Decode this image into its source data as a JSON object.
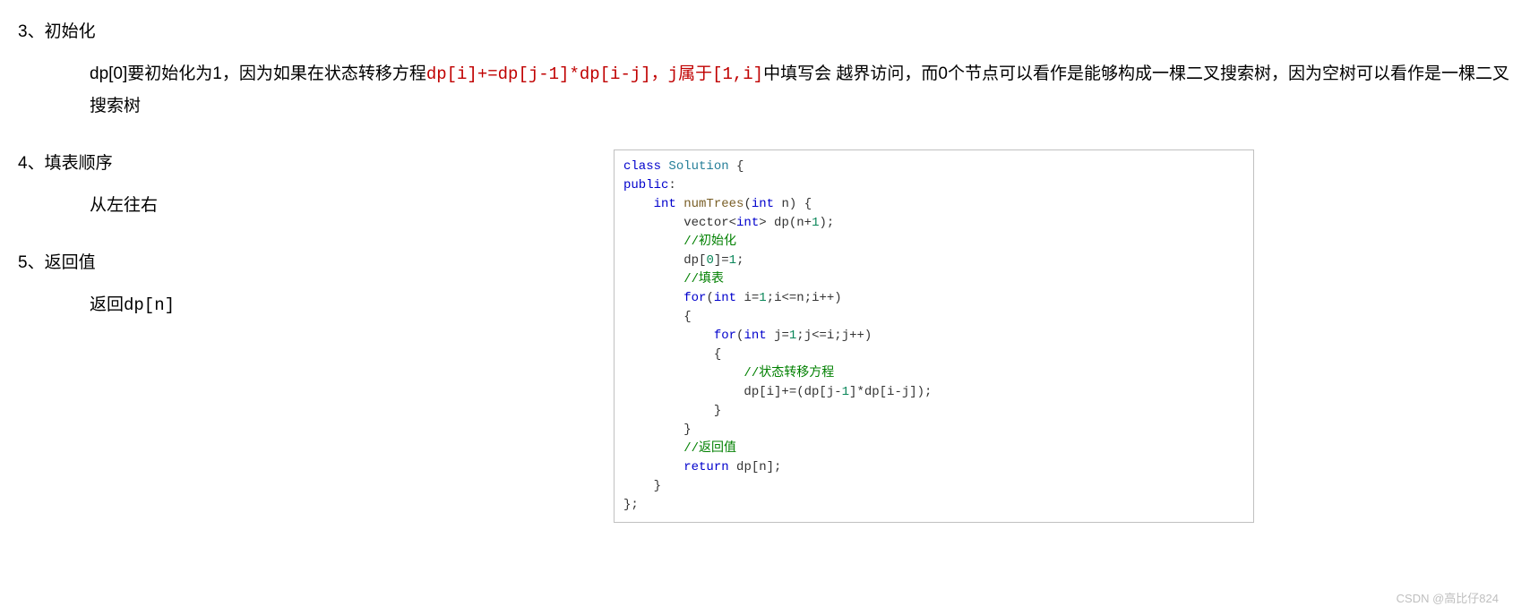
{
  "sections": {
    "s3": {
      "heading": "3、初始化",
      "para_pre": "dp[0]要初始化为1，因为如果在状态转移方程",
      "para_red": "dp[i]+=dp[j-1]*dp[i-j]，j属于[1,i]",
      "para_post": "中填写会 越界访问，而0个节点可以看作是能够构成一棵二叉搜索树，因为空树可以看作是一棵二叉搜索树"
    },
    "s4": {
      "heading": "4、填表顺序",
      "para": "从左往右"
    },
    "s5": {
      "heading": "5、返回值",
      "para": "返回dp[n]"
    }
  },
  "code": {
    "l1_kw1": "class",
    "l1_cls": " Solution ",
    "l1_brace": "{",
    "l2_kw": "public",
    "l2_colon": ":",
    "l3_pad": "    ",
    "l3_type": "int",
    "l3_fn": " numTrees",
    "l3_open": "(",
    "l3_ptype": "int",
    "l3_pname": " n",
    "l3_close": ") {",
    "l4_pad": "        ",
    "l4_a": "vector<",
    "l4_type": "int",
    "l4_b": "> dp(n+",
    "l4_num": "1",
    "l4_c": ");",
    "l5_pad": "        ",
    "l5_cmt": "//初始化",
    "l6_pad": "        ",
    "l6_a": "dp[",
    "l6_n1": "0",
    "l6_b": "]=",
    "l6_n2": "1",
    "l6_c": ";",
    "l7_pad": "        ",
    "l7_cmt": "//填表",
    "l8_pad": "        ",
    "l8_kw": "for",
    "l8_a": "(",
    "l8_type": "int",
    "l8_b": " i=",
    "l8_n": "1",
    "l8_c": ";i<=n;i++)",
    "l9_pad": "        ",
    "l9_brace": "{",
    "l10_pad": "            ",
    "l10_kw": "for",
    "l10_a": "(",
    "l10_type": "int",
    "l10_b": " j=",
    "l10_n": "1",
    "l10_c": ";j<=i;j++)",
    "l11_pad": "            ",
    "l11_brace": "{",
    "l12_pad": "                ",
    "l12_cmt": "//状态转移方程",
    "l13_pad": "                ",
    "l13_a": "dp[i]+=(dp[j-",
    "l13_n1": "1",
    "l13_b": "]*dp[i-j]);",
    "l14_pad": "            ",
    "l14_brace": "}",
    "l15_pad": "        ",
    "l15_brace": "}",
    "l16_pad": "        ",
    "l16_cmt": "//返回值",
    "l17_pad": "        ",
    "l17_kw": "return",
    "l17_a": " dp[n];",
    "l18_pad": "    ",
    "l18_brace": "}",
    "l19": "};"
  },
  "watermark": "CSDN @高比仔824"
}
